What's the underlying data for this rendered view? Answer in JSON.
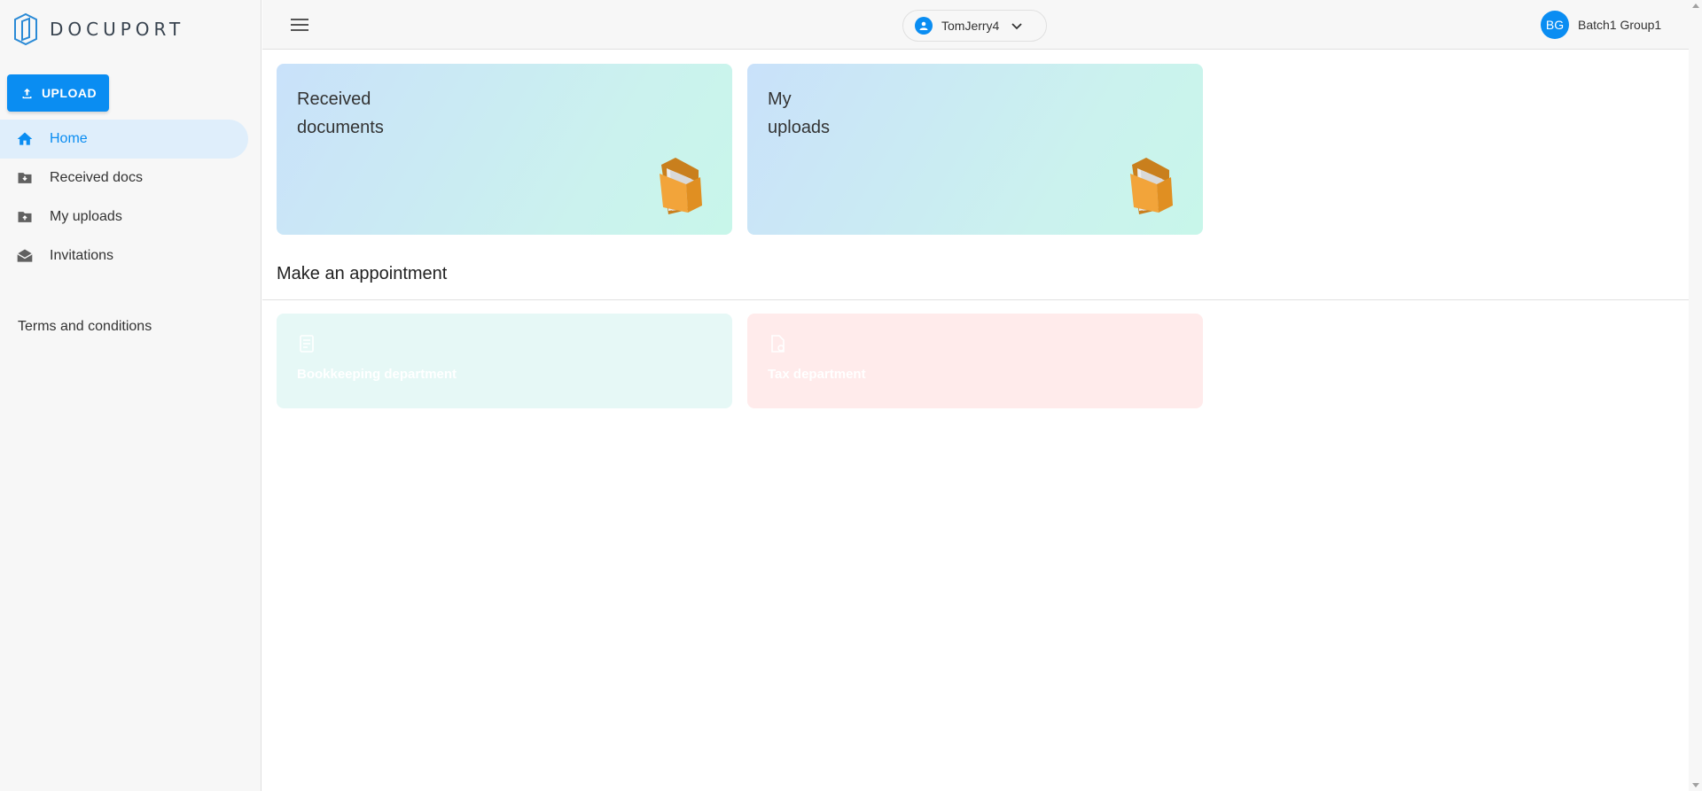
{
  "app": {
    "brand": "DOCUPORT",
    "accent_color": "#0a8df2"
  },
  "sidebar": {
    "upload_label": "UPLOAD",
    "items": [
      {
        "label": "Home",
        "icon": "home-icon",
        "active": true
      },
      {
        "label": "Received docs",
        "icon": "folder-download-icon",
        "active": false
      },
      {
        "label": "My uploads",
        "icon": "folder-upload-icon",
        "active": false
      },
      {
        "label": "Invitations",
        "icon": "envelope-open-icon",
        "active": false
      }
    ],
    "terms_label": "Terms and conditions"
  },
  "topbar": {
    "account_name": "TomJerry4",
    "user_initials": "BG",
    "user_name": "Batch1 Group1"
  },
  "main": {
    "cards": [
      {
        "title": "Received\ndocuments",
        "icon": "folder-icon"
      },
      {
        "title": "My\nuploads",
        "icon": "folder-icon"
      }
    ],
    "appointment_title": "Make an appointment",
    "departments": [
      {
        "label": "Bookkeeping department",
        "icon": "ledger-icon",
        "color": "#e6f8f6"
      },
      {
        "label": "Tax department",
        "icon": "tax-doc-icon",
        "color": "#ffebeb"
      }
    ]
  }
}
